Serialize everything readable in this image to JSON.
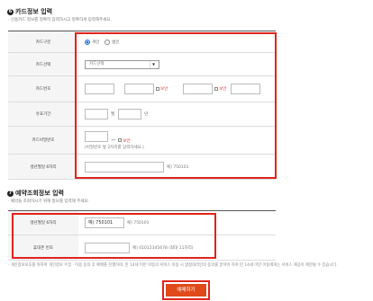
{
  "card_section": {
    "number": "6",
    "title": "카드정보 입력",
    "note": "· 신용카드 정보를 정확히 입력하시고 정확하게 입력해주세요.",
    "card_type": {
      "label": "카드구분",
      "options": [
        "개인",
        "법인"
      ],
      "selected": "개인"
    },
    "card_select": {
      "label": "카드선택",
      "value": "카드선택"
    },
    "card_number": {
      "label": "카드번호",
      "mask_label": "보안"
    },
    "expiry": {
      "label": "유효기간",
      "month_unit": "월",
      "year_unit": "년"
    },
    "password": {
      "label": "카드비밀번호",
      "suffix": "**",
      "mask_label": "보안",
      "hint": "(비밀번호 앞 2자리를 입력하세요.)"
    },
    "birth": {
      "label": "생년월일 6자리",
      "hint": "예) 750101"
    }
  },
  "booker_section": {
    "number": "7",
    "title": "예약조회정보 입력",
    "note": "· 예약을 조회하시기 위해 정보를 입력해 주세요.",
    "birth": {
      "label": "생년월일 6자리",
      "value": "예) 750101",
      "hint": "예) 750101"
    },
    "phone": {
      "label": "휴대폰 번호",
      "hint": "예) 01012345678 (최대 11자리)"
    }
  },
  "footnote": "· 개인정보보호를 위하여 개인정보 수집 · 이용 동의 후 예매를 진행하며, 만 14세 미만 아동의 서비스 이용 시 법정대리인의 동의를 받아야 하며 만 14세 미만 아동에게는 서비스 제공이 제한될 수 있습니다.",
  "reserve_button": "예매하기"
}
